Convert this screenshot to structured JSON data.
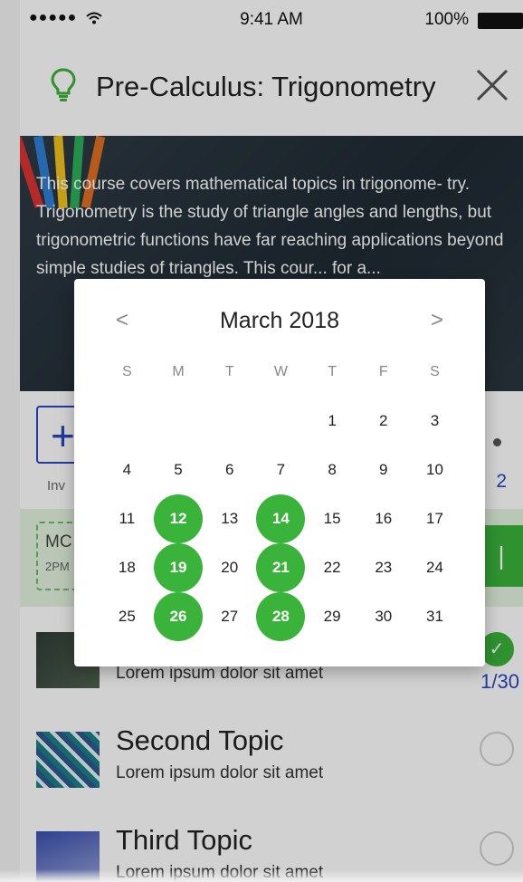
{
  "status": {
    "signal": "●●●●● ",
    "wifi_icon": "wifi-icon",
    "time": "9:41 AM",
    "battery": "100%"
  },
  "header": {
    "title": "Pre-Calculus: Trigonometry"
  },
  "hero": {
    "description": "This course covers mathematical topics in trigonome- try. Trigonometry is the study of triangle angles and lengths, but trigonometric functions have far reaching applications beyond simple studies of triangles. This cour... for a..."
  },
  "actions": {
    "invite_label": "Inv",
    "count": "2"
  },
  "schedule": {
    "line1": "MC",
    "line2": "2PM"
  },
  "topics": [
    {
      "name": "",
      "subtitle": "Lorem ipsum dolor sit amet",
      "progress": "1/30"
    },
    {
      "name": "Second Topic",
      "subtitle": "Lorem ipsum dolor sit amet"
    },
    {
      "name": "Third Topic",
      "subtitle": "Lorem ipsum dolor sit amet"
    }
  ],
  "calendar": {
    "prev": "<",
    "next": ">",
    "month": "March 2018",
    "weekdays": [
      "S",
      "M",
      "T",
      "W",
      "T",
      "F",
      "S"
    ],
    "weeks": [
      [
        "",
        "",
        "",
        "",
        "1",
        "2",
        "3"
      ],
      [
        "4",
        "5",
        "6",
        "7",
        "8",
        "9",
        "10"
      ],
      [
        "11",
        "12",
        "13",
        "14",
        "15",
        "16",
        "17"
      ],
      [
        "18",
        "19",
        "20",
        "21",
        "22",
        "23",
        "24"
      ],
      [
        "25",
        "26",
        "27",
        "28",
        "29",
        "30",
        "31"
      ]
    ],
    "selected": [
      "12",
      "14",
      "19",
      "21",
      "26",
      "28"
    ]
  },
  "colors": {
    "accent": "#3ab33a",
    "link": "#2a46c0"
  }
}
